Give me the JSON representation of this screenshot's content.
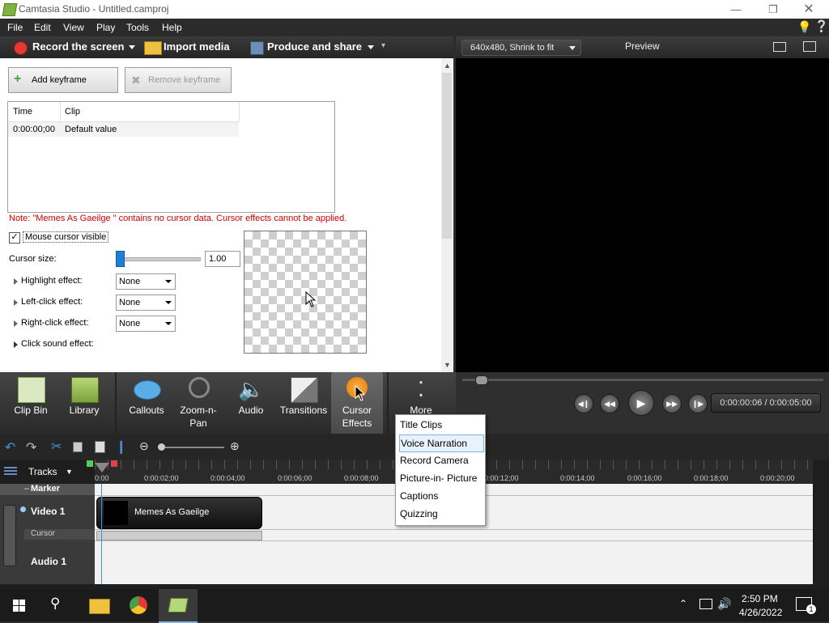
{
  "window": {
    "title": "Camtasia Studio - Untitled.camproj"
  },
  "menu": [
    "File",
    "Edit",
    "View",
    "Play",
    "Tools",
    "Help"
  ],
  "toolbar": {
    "record": "Record the screen",
    "import": "Import media",
    "produce": "Produce and share"
  },
  "keyframes": {
    "add": "Add keyframe",
    "remove": "Remove keyframe"
  },
  "table": {
    "headers": [
      "Time",
      "Clip"
    ],
    "rows": [
      {
        "time": "0:00:00;00",
        "clip": "Default value"
      }
    ]
  },
  "note": "Note: \"Memes As Gaeilge \" contains no cursor data. Cursor effects cannot be applied.",
  "cursor": {
    "visible_label": "Mouse cursor visible",
    "size_label": "Cursor size:",
    "size_value": "1.00",
    "size_fraction": 0.0,
    "highlight_label": "Highlight effect:",
    "highlight_value": "None",
    "left_label": "Left-click effect:",
    "left_value": "None",
    "right_label": "Right-click effect:",
    "right_value": "None",
    "sound_label": "Click sound effect:"
  },
  "preview": {
    "size_option": "640x480, Shrink to fit",
    "label": "Preview",
    "time": "0:00:00:06 / 0:00:05:00"
  },
  "tabs": [
    {
      "line1": "Clip Bin",
      "line2": ""
    },
    {
      "line1": "Library",
      "line2": ""
    },
    {
      "line1": "Callouts",
      "line2": ""
    },
    {
      "line1": "Zoom-n-",
      "line2": "Pan"
    },
    {
      "line1": "Audio",
      "line2": ""
    },
    {
      "line1": "Transitions",
      "line2": ""
    },
    {
      "line1": "Cursor",
      "line2": "Effects"
    },
    {
      "line1": "More",
      "line2": ""
    }
  ],
  "more_menu": [
    "Title Clips",
    "Voice Narration",
    "Record Camera",
    "Picture-in- Picture",
    "Captions",
    "Quizzing"
  ],
  "timeline": {
    "tracks_label": "Tracks",
    "ticks": [
      "0:00",
      "0:00:02;00",
      "0:00:04;00",
      "0:00:06;00",
      "0:00:08;00",
      "0:00:12;00",
      "0:00:14;00",
      "0:00:16;00",
      "0:00:18;00",
      "0:00:20;00"
    ],
    "marker": "Marker",
    "video": "Video 1",
    "cursor": "Cursor",
    "audio": "Audio 1",
    "clip": "Memes As Gaeilge"
  },
  "taskbar": {
    "time": "2:50 PM",
    "date": "4/26/2022",
    "notif": "1"
  },
  "colors": {
    "accent": "#4a90d9",
    "note": "#d40000",
    "record": "#e53935"
  }
}
